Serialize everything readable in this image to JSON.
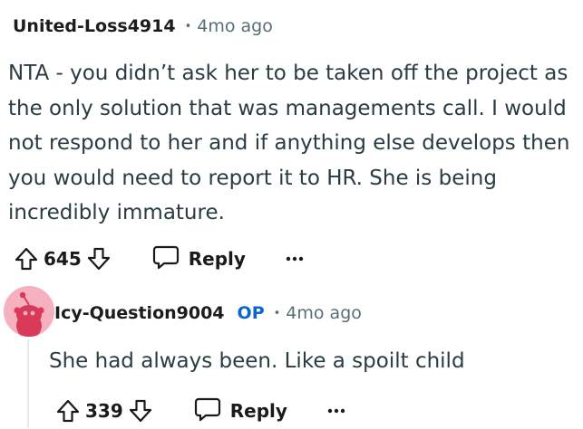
{
  "comment": {
    "author": "United-Loss4914",
    "separator": "•",
    "time": "4mo ago",
    "body": "NTA - you didn’t ask her to be taken off the project as the only solution that was managements call. I would not respond to her and if anything else develops then you would need to report it to HR. She is being incredibly immature.",
    "votes": "645",
    "reply_label": "Reply",
    "more_label": "more-options-icon"
  },
  "reply": {
    "author": "Icy-Question9004",
    "badge": "OP",
    "separator": "•",
    "time": "4mo ago",
    "body": "She had always been. Like a spoilt child",
    "votes": "339",
    "reply_label": "Reply",
    "more_label": "more-options-icon"
  },
  "colors": {
    "badge": "#0a66d6",
    "meta": "#576f76",
    "avatar_bg": "#f5b1bf",
    "avatar_fg": "#d93a5a",
    "thread_line": "#e5ebee"
  }
}
